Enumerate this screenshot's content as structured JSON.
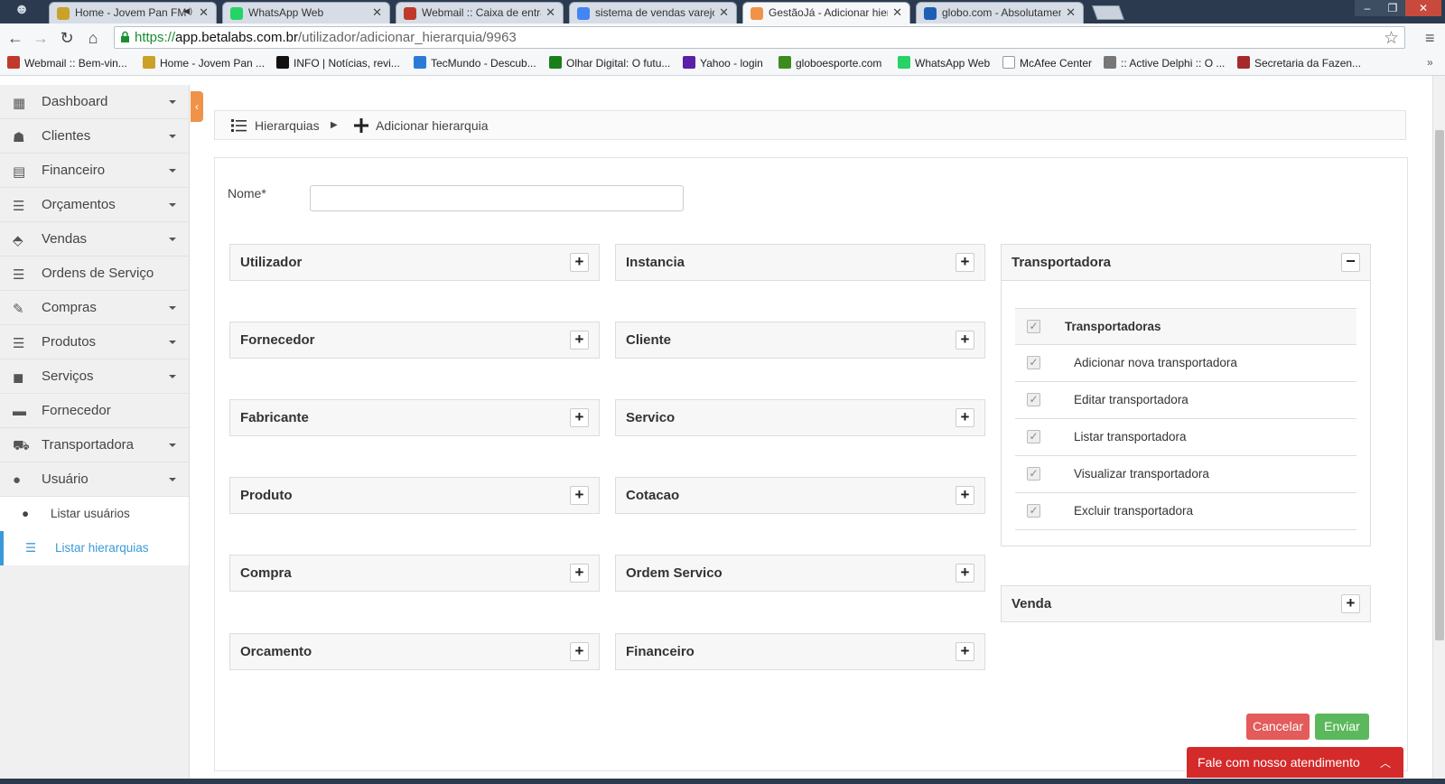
{
  "browser": {
    "tabs": [
      {
        "title": "Home - Jovem Pan FM",
        "icon": "jovem-pan-icon",
        "color": "#c9a227",
        "has_audio": true
      },
      {
        "title": "WhatsApp Web",
        "icon": "whatsapp-icon",
        "color": "#25d366"
      },
      {
        "title": "Webmail :: Caixa de entra",
        "icon": "webmail-icon",
        "color": "#c0392b"
      },
      {
        "title": "sistema de vendas varejo",
        "icon": "google-icon",
        "color": "#4285f4"
      },
      {
        "title": "GestãoJá - Adicionar hiera",
        "icon": "gestaoja-icon",
        "color": "#f0934a",
        "active": true
      },
      {
        "title": "globo.com - Absolutamen",
        "icon": "globo-icon",
        "color": "#1e5fb4"
      }
    ],
    "url": {
      "scheme": "https://",
      "host": "app.betalabs.com.br",
      "path": "/utilizador/adicionar_hierarquia/9963"
    },
    "bookmarks": [
      {
        "label": "Webmail :: Bem-vin...",
        "icon": "webmail-icon",
        "color": "#c0392b"
      },
      {
        "label": "Home - Jovem Pan ...",
        "icon": "jovem-pan-icon",
        "color": "#c9a227"
      },
      {
        "label": "INFO | Notícias, revi...",
        "icon": "info-icon",
        "color": "#111111"
      },
      {
        "label": "TecMundo - Descub...",
        "icon": "tecmundo-icon",
        "color": "#2b7bd6"
      },
      {
        "label": "Olhar Digital: O futu...",
        "icon": "olhar-digital-icon",
        "color": "#1a7f1a"
      },
      {
        "label": "Yahoo - login",
        "icon": "yahoo-icon",
        "color": "#5c1fa8"
      },
      {
        "label": "globoesporte.com",
        "icon": "ge-icon",
        "color": "#3d8b1f"
      },
      {
        "label": "WhatsApp Web",
        "icon": "whatsapp-icon",
        "color": "#25d366"
      },
      {
        "label": "McAfee Center",
        "icon": "page-icon",
        "color": "#ffffff"
      },
      {
        "label": ":: Active Delphi :: O ...",
        "icon": "delphi-icon",
        "color": "#777777"
      },
      {
        "label": "Secretaria da Fazen...",
        "icon": "sefaz-icon",
        "color": "#a52a2a"
      }
    ]
  },
  "sidebar": {
    "items": [
      {
        "label": "Dashboard",
        "icon": "dashboard-icon",
        "caret": true
      },
      {
        "label": "Clientes",
        "icon": "clients-icon",
        "caret": true
      },
      {
        "label": "Financeiro",
        "icon": "calculator-icon",
        "caret": true
      },
      {
        "label": "Orçamentos",
        "icon": "list-icon",
        "caret": true
      },
      {
        "label": "Vendas",
        "icon": "tag-icon",
        "caret": true
      },
      {
        "label": "Ordens de Serviço",
        "icon": "list-icon",
        "caret": false
      },
      {
        "label": "Compras",
        "icon": "pen-icon",
        "caret": true
      },
      {
        "label": "Produtos",
        "icon": "list-icon",
        "caret": true
      },
      {
        "label": "Serviços",
        "icon": "briefcase-icon",
        "caret": true
      },
      {
        "label": "Fornecedor",
        "icon": "box-icon",
        "caret": false
      },
      {
        "label": "Transportadora",
        "icon": "car-icon",
        "caret": true
      },
      {
        "label": "Usuário",
        "icon": "user-icon",
        "caret": true
      }
    ],
    "subitems": [
      {
        "label": "Listar usuários",
        "icon": "user-icon",
        "active": false
      },
      {
        "label": "Listar hierarquias",
        "icon": "list-icon",
        "active": true
      }
    ]
  },
  "breadcrumb": {
    "items": [
      {
        "label": "Hierarquias",
        "icon": "list-icon"
      },
      {
        "label": "Adicionar hierarquia",
        "icon": "plus-icon"
      }
    ]
  },
  "form": {
    "name_label": "Nome*",
    "name_value": "",
    "boxes_col1": [
      "Utilizador",
      "Fornecedor",
      "Fabricante",
      "Produto",
      "Compra",
      "Orcamento"
    ],
    "boxes_col2": [
      "Instancia",
      "Cliente",
      "Servico",
      "Cotacao",
      "Ordem Servico",
      "Financeiro"
    ],
    "expanded": {
      "title": "Transportadora",
      "toggle": "−",
      "header": "Transportadoras",
      "permissions": [
        "Adicionar nova transportadora",
        "Editar transportadora",
        "Listar transportadora",
        "Visualizar transportadora",
        "Excluir transportadora"
      ]
    },
    "box_col3": "Venda",
    "expand_symbol": "+",
    "cancel_label": "Cancelar",
    "submit_label": "Enviar"
  },
  "chat": {
    "label": "Fale com nosso atendimento"
  },
  "colors": {
    "accent": "#3a9ad9",
    "cancel": "#e35b5a",
    "submit": "#5cb85c",
    "chat": "#d42a2a",
    "sidebar_toggle": "#f0934a"
  }
}
